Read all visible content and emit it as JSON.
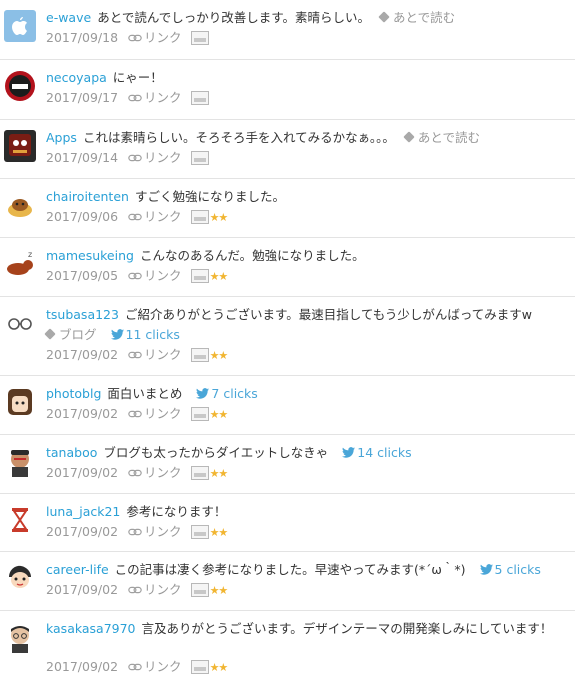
{
  "comments": [
    {
      "user": "e-wave",
      "text": "あとで読んでしっかり改善します。素晴らしい。",
      "read_later": "あとで読む",
      "date": "2017/09/18",
      "link_label": "リンク",
      "stars": ""
    },
    {
      "user": "necoyapa",
      "text": "にゃー！",
      "date": "2017/09/17",
      "link_label": "リンク",
      "stars": ""
    },
    {
      "user": "Apps",
      "text": "これは素晴らしい。そろそろ手を入れてみるかなぁ。。。",
      "read_later": "あとで読む",
      "date": "2017/09/14",
      "link_label": "リンク",
      "stars": ""
    },
    {
      "user": "chairoitenten",
      "text": "すごく勉強になりました。",
      "date": "2017/09/06",
      "link_label": "リンク",
      "stars": "★★"
    },
    {
      "user": "mamesukeing",
      "text": "こんなのあるんだ。勉強になりました。",
      "date": "2017/09/05",
      "link_label": "リンク",
      "stars": "★★"
    },
    {
      "user": "tsubasa123",
      "text": "ご紹介ありがとうございます。最速目指してもう少しがんばってみますw",
      "tag": "ブログ",
      "clicks": "11 clicks",
      "date": "2017/09/02",
      "link_label": "リンク",
      "stars": "★★"
    },
    {
      "user": "photoblg",
      "text": "面白いまとめ",
      "clicks": "7 clicks",
      "date": "2017/09/02",
      "link_label": "リンク",
      "stars": "★★"
    },
    {
      "user": "tanaboo",
      "text": "ブログも太ったからダイエットしなきゃ",
      "clicks": "14 clicks",
      "date": "2017/09/02",
      "link_label": "リンク",
      "stars": "★★"
    },
    {
      "user": "luna_jack21",
      "text": "参考になります！",
      "date": "2017/09/02",
      "link_label": "リンク",
      "stars": "★★"
    },
    {
      "user": "career-life",
      "text": "この記事は凄く参考になりました。早速やってみます(*´ω｀*)",
      "clicks": "5 clicks",
      "date": "2017/09/02",
      "link_label": "リンク",
      "stars": "★★"
    },
    {
      "user": "kasakasa7970",
      "text": "言及ありがとうございます。デザインテーマの開発楽しみにしています！",
      "date": "2017/09/02",
      "link_label": "リンク",
      "stars": "★★"
    }
  ],
  "colors": {
    "accent": "#2aa0d6",
    "muted": "#999999",
    "star": "#f1b531",
    "separator": "#e3e3e3"
  },
  "avatar_icons": [
    "apple-logo-icon",
    "cat-logo-icon",
    "robot-face-icon",
    "bear-pudding-icon",
    "cat-lying-icon",
    "glasses-icon",
    "girl-face-icon",
    "man-face-icon",
    "hourglass-icon",
    "anime-face-icon",
    "man-glasses-icon"
  ]
}
